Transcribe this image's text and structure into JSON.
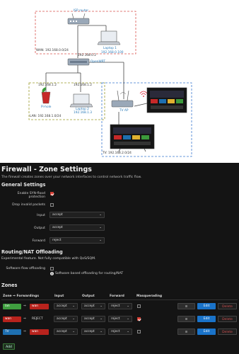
{
  "diagram": {
    "isp_router": "ISP router",
    "laptop1": [
      "Laptop 1",
      "192.168.0.100"
    ],
    "wan_label": "WAN: 192.168.0.0/24",
    "openwrt_ip": "192.168.0.2",
    "openwrt": "OpenWRT",
    "pihole_ip": "192.168.1.2",
    "pihole": "Pi-hole",
    "laptop2_ip": "192.168.1.2",
    "laptop2": [
      "Laptop 2",
      "192.168.1.3"
    ],
    "lan_label": "LAN: 192.168.1.0/24",
    "tvap": "TV AP",
    "tv_label": "TV: 192.168.2.0/24"
  },
  "page": {
    "title": "Firewall - Zone Settings",
    "description": "The firewall creates zones over your network interfaces to control network traffic flow."
  },
  "general": {
    "heading": "General Settings",
    "syn_label": "Enable SYN-flood protection",
    "syn_checked": true,
    "drop_label": "Drop invalid packets",
    "drop_checked": false,
    "input_label": "Input",
    "input_value": "accept",
    "output_label": "Output",
    "output_value": "accept",
    "forward_label": "Forward",
    "forward_value": "reject"
  },
  "routing": {
    "heading": "Routing/NAT Offloading",
    "desc": "Experimental feature. Not fully compatible with QoS/SQM.",
    "sfo_label": "Software flow offloading",
    "sfo_checked": false,
    "info_note": "Software based offloading for routing/NAT"
  },
  "zones": {
    "heading": "Zones",
    "headers": {
      "forwarding": "Zone ⇒ Forwardings",
      "input": "Input",
      "output": "Output",
      "forward": "Forward",
      "masq": "Masquerading"
    },
    "rows": [
      {
        "zone": "lan",
        "zone_color": "#3f9e3f",
        "arrow": "⇒",
        "forward_to": "wan",
        "forward_color": "#b8231d",
        "input": "accept",
        "output": "accept",
        "forward": "reject",
        "masq": false
      },
      {
        "zone": "wan",
        "zone_color": "#b8231d",
        "arrow": "⇒",
        "forward_to": "REJECT",
        "forward_color": "",
        "input": "accept",
        "output": "accept",
        "forward": "reject",
        "masq": true
      },
      {
        "zone": "TV",
        "zone_color": "#1e6fb0",
        "arrow": "⇒",
        "forward_to": "wan",
        "forward_color": "#b8231d",
        "input": "accept",
        "output": "accept",
        "forward": "reject",
        "masq": false
      }
    ],
    "menu_label": "≡",
    "edit_label": "Edit",
    "delete_label": "Delete",
    "add_label": "Add"
  },
  "colors": {
    "wan_border": "#d9534f",
    "lan_border": "#9a9a2a",
    "tv_border": "#3a78d0",
    "panel_bg": "#141414"
  }
}
